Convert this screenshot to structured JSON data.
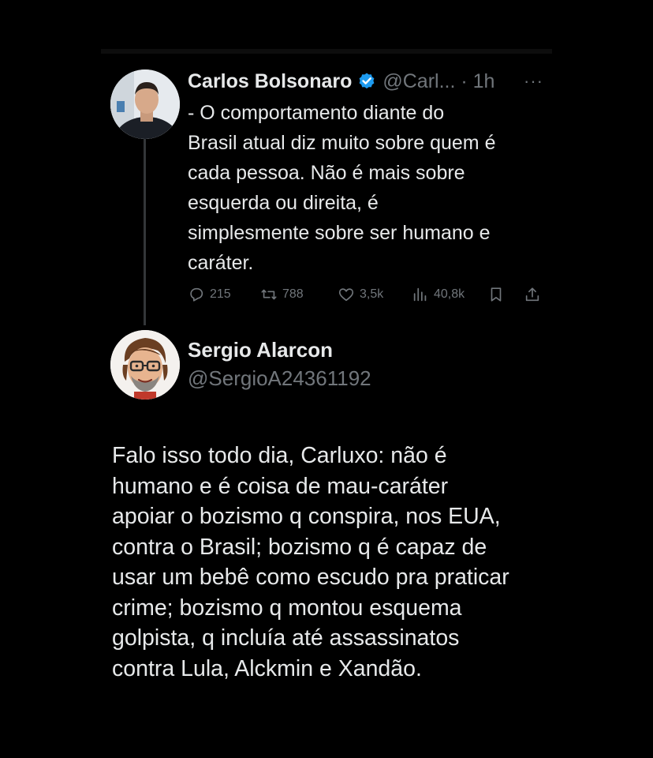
{
  "tweet": {
    "author_name": "Carlos Bolsonaro",
    "author_handle_time": "@Carl... · 1h",
    "more_label": "···",
    "text_lines": [
      "- O comportamento diante do",
      "Brasil atual diz muito sobre quem é",
      "cada pessoa. Não é mais sobre",
      "esquerda ou direita, é",
      "simplesmente sobre ser humano e",
      "caráter."
    ],
    "actions": {
      "replies": "215",
      "reposts": "788",
      "likes": "3,5k",
      "views": "40,8k"
    },
    "icons": {
      "verified": "verified-badge-icon",
      "reply": "reply-icon",
      "repost": "repost-icon",
      "like": "heart-icon",
      "views": "views-icon",
      "bookmark": "bookmark-icon",
      "share": "share-icon"
    }
  },
  "reply": {
    "author_name": "Sergio Alarcon",
    "author_handle": "@SergioA24361192",
    "text_lines": [
      "Falo isso todo dia, Carluxo: não é",
      "humano e é coisa de mau-caráter",
      "apoiar o bozismo q conspira, nos EUA,",
      "contra o Brasil; bozismo q é capaz de",
      "usar um bebê como escudo pra praticar",
      "crime; bozismo q montou esquema",
      "golpista, q incluía até assassinatos",
      "contra Lula, Alckmin e Xandão."
    ]
  },
  "colors": {
    "background": "#000000",
    "text_primary": "#e7e9ea",
    "text_secondary": "#71767b",
    "verified_blue": "#1d9bf0",
    "thread_line": "#333639"
  }
}
